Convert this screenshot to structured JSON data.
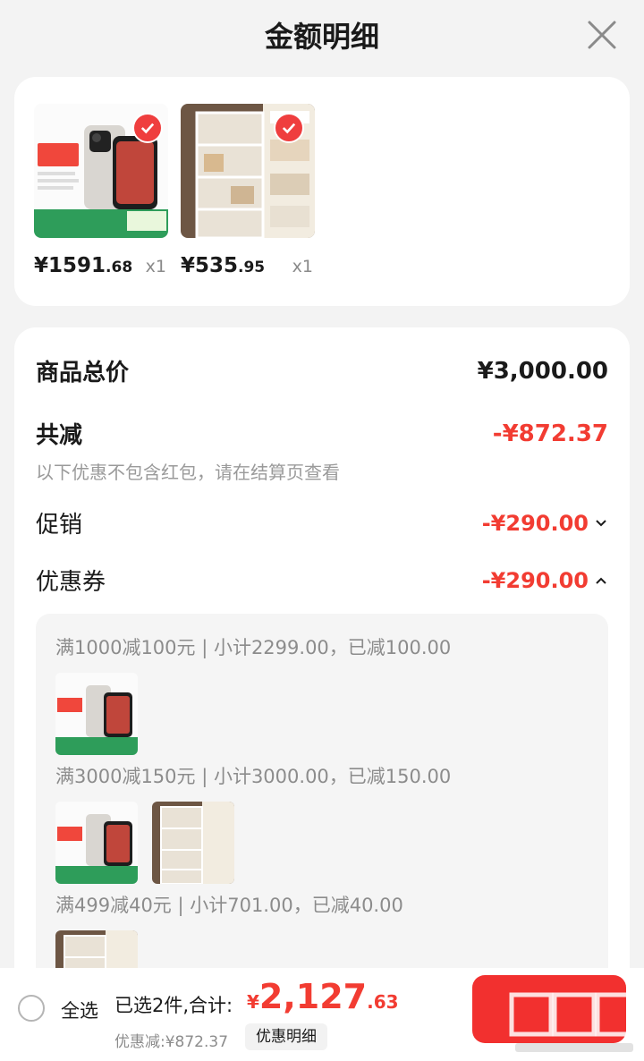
{
  "header": {
    "title": "金额明细"
  },
  "products": [
    {
      "price_int": "¥1591",
      "price_dec": ".68",
      "qty": "x1",
      "kind": "phone"
    },
    {
      "price_int": "¥535",
      "price_dec": ".95",
      "qty": "x1",
      "kind": "shelf"
    }
  ],
  "summary": {
    "total_label": "商品总价",
    "total_value": "¥3,000.00",
    "reduce_label": "共减",
    "reduce_value": "-¥872.37",
    "note": "以下优惠不包含红包，请在结算页查看",
    "promo_label": "促销",
    "promo_value": "-¥290.00",
    "coupon_label": "优惠券",
    "coupon_value": "-¥290.00"
  },
  "coupons": [
    {
      "text": "满1000减100元 | 小计2299.00，已减100.00"
    },
    {
      "text": "满3000减150元 | 小计3000.00，已减150.00"
    },
    {
      "text": "满499减40元 | 小计701.00，已减40.00"
    }
  ],
  "bottom": {
    "select_all": "全选",
    "selected": "已选2件,合计:",
    "total_symbol": "¥",
    "total_int": "2,127",
    "total_dec": ".63",
    "discount": "优惠减:¥872.37",
    "detail_button": "优惠明细"
  },
  "colors": {
    "accent": "#f23c32",
    "button": "#f2302f"
  },
  "icons": {
    "close": "close-icon",
    "check": "check-icon",
    "chevron_down": "chevron-down-icon",
    "chevron_up": "chevron-up-icon"
  }
}
